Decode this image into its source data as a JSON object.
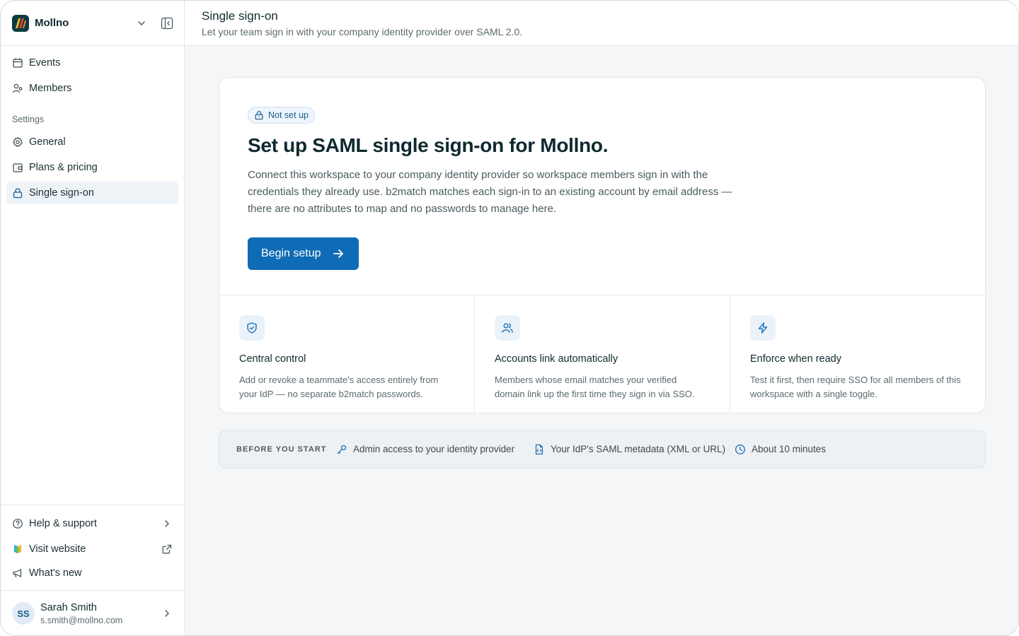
{
  "workspace": {
    "name": "Mollno"
  },
  "nav": {
    "items": [
      {
        "label": "Events",
        "icon": "calendar-icon"
      },
      {
        "label": "Members",
        "icon": "members-icon"
      }
    ],
    "settings_heading": "Settings",
    "settings_items": [
      {
        "label": "General",
        "icon": "gear-icon"
      },
      {
        "label": "Plans & pricing",
        "icon": "wallet-icon"
      },
      {
        "label": "Single sign-on",
        "icon": "lock-icon",
        "active": true
      }
    ]
  },
  "sidebar_bottom": {
    "help": "Help & support",
    "website": "Visit website",
    "whats_new": "What's new"
  },
  "user": {
    "initials": "SS",
    "name": "Sarah Smith",
    "email": "s.smith@mollno.com"
  },
  "header": {
    "title": "Single sign-on",
    "subtitle": "Let your team sign in with your company identity provider over SAML 2.0."
  },
  "hero": {
    "badge": "Not set up",
    "title": "Set up SAML single sign-on for Mollno.",
    "description": "Connect this workspace to your company identity provider so workspace members sign in with the credentials they already use. b2match matches each sign-in to an existing account by email address — there are no attributes to map and no passwords to manage here.",
    "cta": "Begin setup"
  },
  "features": [
    {
      "title": "Central control",
      "description": "Add or revoke a teammate's access entirely from your IdP — no separate b2match passwords.",
      "icon": "shield-check-icon"
    },
    {
      "title": "Accounts link automatically",
      "description": "Members whose email matches your verified domain link up the first time they sign in via SSO.",
      "icon": "users-icon"
    },
    {
      "title": "Enforce when ready",
      "description": "Test it first, then require SSO for all members of this workspace with a single toggle.",
      "icon": "lightning-icon"
    }
  ],
  "prereq": {
    "label": "BEFORE YOU START",
    "items": [
      {
        "text": "Admin access to your identity provider",
        "icon": "key-icon"
      },
      {
        "text": "Your IdP's SAML metadata (XML or URL)",
        "icon": "file-code-icon"
      },
      {
        "text": "About 10 minutes",
        "icon": "clock-icon"
      }
    ]
  },
  "colors": {
    "accent": "#0f6bb5",
    "background": "#f4f6f8",
    "badge_bg": "#eef5fc"
  }
}
